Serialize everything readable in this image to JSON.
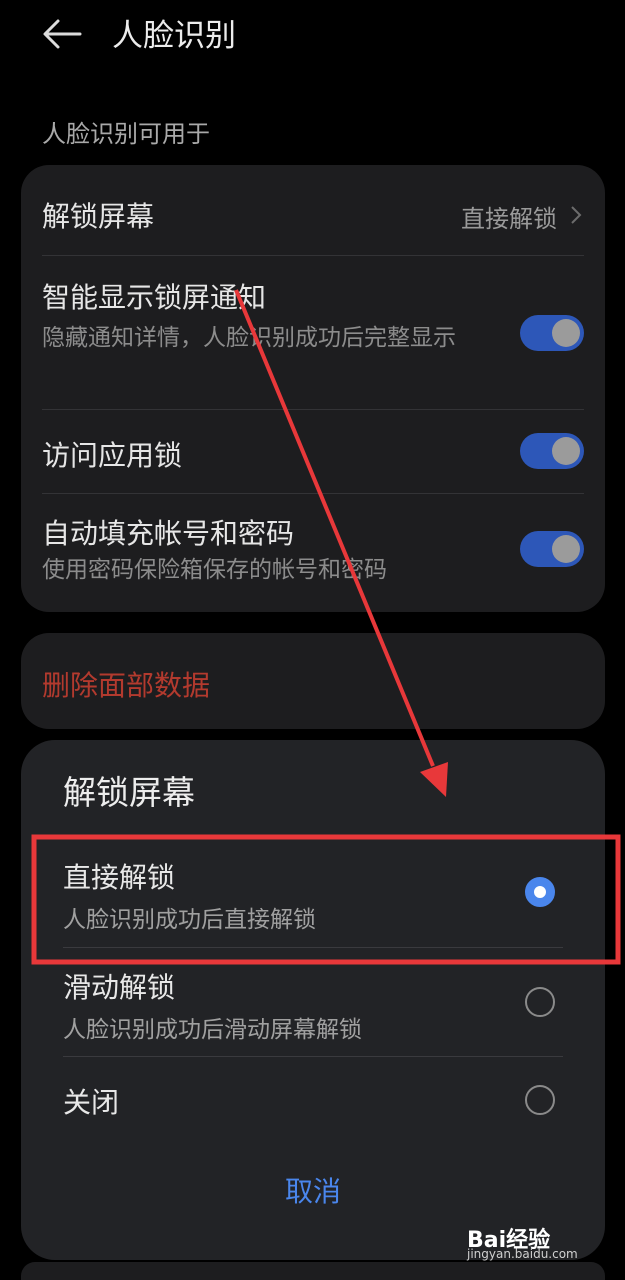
{
  "header": {
    "title": "人脸识别"
  },
  "section_label": "人脸识别可用于",
  "settings": {
    "unlock_screen": {
      "title": "解锁屏幕",
      "value": "直接解锁"
    },
    "smart_notifications": {
      "title": "智能显示锁屏通知",
      "subtitle": "隐藏通知详情，人脸识别成功后完整显示",
      "enabled": true
    },
    "app_lock": {
      "title": "访问应用锁",
      "enabled": true
    },
    "autofill": {
      "title": "自动填充帐号和密码",
      "subtitle": "使用密码保险箱保存的帐号和密码",
      "enabled": true
    }
  },
  "delete_face_data": "删除面部数据",
  "dialog": {
    "title": "解锁屏幕",
    "options": [
      {
        "title": "直接解锁",
        "subtitle": "人脸识别成功后直接解锁",
        "selected": true
      },
      {
        "title": "滑动解锁",
        "subtitle": "人脸识别成功后滑动屏幕解锁",
        "selected": false
      },
      {
        "title": "关闭",
        "subtitle": "",
        "selected": false
      }
    ],
    "cancel": "取消"
  },
  "colors": {
    "accent": "#4a86ec",
    "toggle_on": "#2d57b8",
    "danger": "#b33a2e",
    "annotation": "#e8383a"
  },
  "watermark": {
    "brand": "Bai经验",
    "url": "jingyan.baidu.com"
  }
}
